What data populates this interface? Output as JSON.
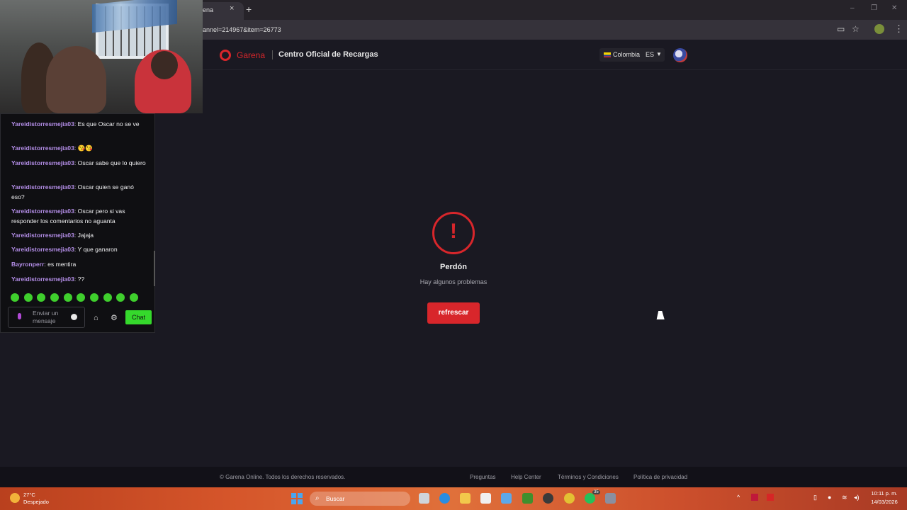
{
  "browser": {
    "tab_title": "ena",
    "tab_close": "×",
    "new_tab": "+",
    "url": "annel=214967&item=26773",
    "window_minimize": "–",
    "window_restore": "❐",
    "window_close": "✕"
  },
  "site": {
    "logo_text": "Garena",
    "title": "Centro Oficial de Recargas",
    "country": "Colombia",
    "language": "ES"
  },
  "error": {
    "mark": "!",
    "title": "Perdón",
    "subtitle": "Hay algunos problemas",
    "refresh_label": "refrescar"
  },
  "footer": {
    "copyright": "© Garena Online. Todos los derechos reservados.",
    "links": [
      "Preguntas",
      "Help Center",
      "Términos y Condiciones",
      "Política de privacidad"
    ]
  },
  "chat": {
    "messages": [
      {
        "user": "Yareidistorresmejia03",
        "text": ": Es que Oscar no se ve"
      },
      {
        "user": "Yareidistorresmejia03",
        "text": ": 😘😘"
      },
      {
        "user": "Yareidistorresmejia03",
        "text": ": Oscar sabe que lo quiero"
      },
      {
        "user": "Yareidistorresmejia03",
        "text": ": Oscar quien se ganó eso?"
      },
      {
        "user": "Yareidistorresmejia03",
        "text": ": Oscar pero si vas responder los comentarios no aguanta"
      },
      {
        "user": "Yareidistorresmejia03",
        "text": ": Jajaja"
      },
      {
        "user": "Yareidistorresmejia03",
        "text": ": Y que ganaron"
      },
      {
        "user": "Bayronperr",
        "text": ": es mentira"
      },
      {
        "user": "Yareidistorresmejia03",
        "text": ": ??"
      }
    ],
    "input_placeholder": "Enviar un mensaje",
    "send_label": "Chat"
  },
  "taskbar": {
    "temperature": "27°C",
    "weather": "Despejado",
    "search_label": "Buscar",
    "time": "10:11 p. m.",
    "date": "14/03/2026",
    "whatsapp_badge": "35"
  },
  "colors": {
    "accent": "#d8262b",
    "chat_user": "#b48ee8",
    "chat_button": "#35d92c"
  }
}
